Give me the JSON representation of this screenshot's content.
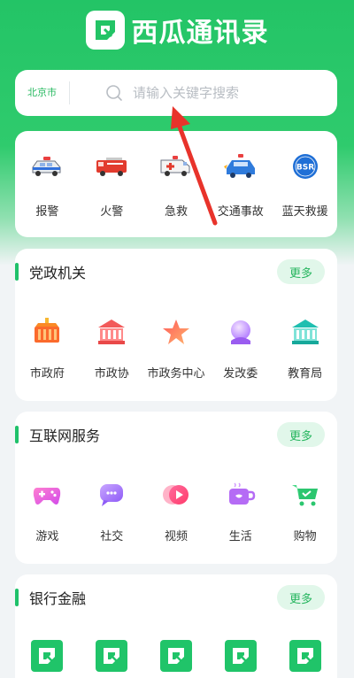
{
  "app": {
    "title": "西瓜通讯录"
  },
  "search": {
    "city": "北京市",
    "placeholder": "请输入关键字搜索"
  },
  "emergency": [
    {
      "label": "报警",
      "icon": "police-car-icon"
    },
    {
      "label": "火警",
      "icon": "fire-truck-icon"
    },
    {
      "label": "急救",
      "icon": "ambulance-icon"
    },
    {
      "label": "交通事故",
      "icon": "traffic-accident-icon"
    },
    {
      "label": "蓝天救援",
      "icon": "bsr-rescue-icon",
      "badge": "BSR"
    }
  ],
  "sections": [
    {
      "title": "党政机关",
      "more": "更多",
      "items": [
        {
          "label": "市政府",
          "icon": "government-building-icon"
        },
        {
          "label": "市政协",
          "icon": "cppcc-building-icon"
        },
        {
          "label": "市政务中心",
          "icon": "star-icon"
        },
        {
          "label": "发改委",
          "icon": "orb-icon"
        },
        {
          "label": "教育局",
          "icon": "education-building-icon"
        }
      ]
    },
    {
      "title": "互联网服务",
      "more": "更多",
      "items": [
        {
          "label": "游戏",
          "icon": "gamepad-icon"
        },
        {
          "label": "社交",
          "icon": "chat-bubble-icon"
        },
        {
          "label": "视频",
          "icon": "play-icon"
        },
        {
          "label": "生活",
          "icon": "cup-icon"
        },
        {
          "label": "购物",
          "icon": "shopping-cart-icon"
        }
      ]
    },
    {
      "title": "银行金融",
      "more": "更多",
      "items": [
        {
          "icon": "app-logo-icon"
        },
        {
          "icon": "app-logo-icon"
        },
        {
          "icon": "app-logo-icon"
        },
        {
          "icon": "app-logo-icon"
        },
        {
          "icon": "app-logo-icon"
        }
      ]
    }
  ],
  "colors": {
    "brand": "#23c466",
    "more_bg": "#e1f7ea",
    "more_text": "#25b55e",
    "annotation_arrow": "#e8332b"
  }
}
